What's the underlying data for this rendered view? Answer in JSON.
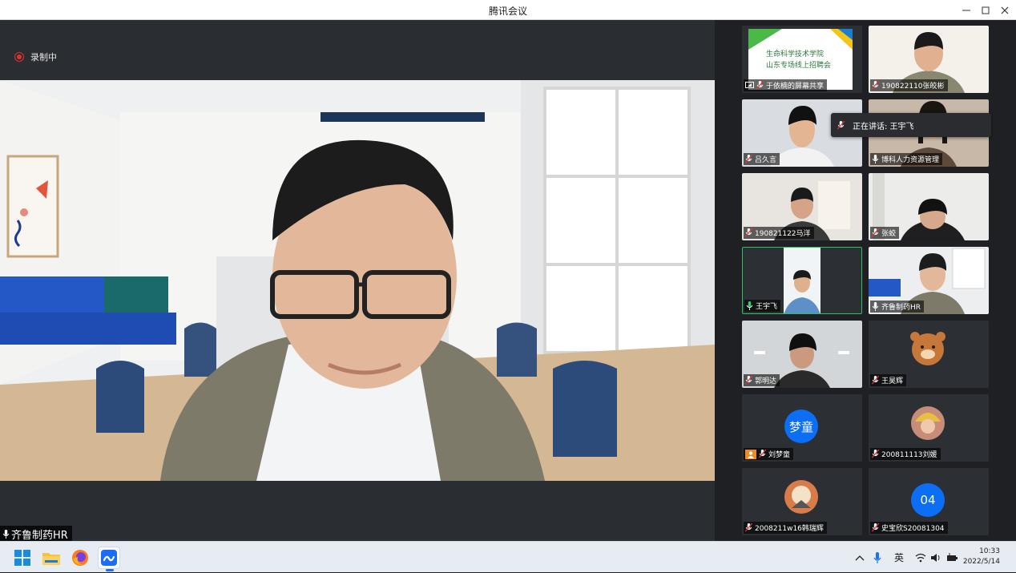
{
  "window": {
    "title": "腾讯会议"
  },
  "main": {
    "recording_label": "录制中",
    "active_speaker": "齐鲁制药HR"
  },
  "tooltip": {
    "speaking_text": "正在讲话: 王宇飞"
  },
  "tiles": [
    {
      "name": "于依楠的屏幕共享",
      "share_title_1": "生命科学技术学院",
      "share_title_2": "山东专场线上招聘会"
    },
    {
      "name": "190822110张皎彬"
    },
    {
      "name": "吕久言"
    },
    {
      "name": "博科人力资源管理"
    },
    {
      "name": "190821122马洋"
    },
    {
      "name": "张蛟"
    },
    {
      "name": "王宇飞"
    },
    {
      "name": "齐鲁制药HR"
    },
    {
      "name": "郭明达"
    },
    {
      "name": "王昊辉"
    },
    {
      "name": "刘梦童",
      "avatar_text": "梦童"
    },
    {
      "name": "200811113刘媛"
    },
    {
      "name": "2008211w16韩瑞辉"
    },
    {
      "name": "史宝欣S20081304",
      "avatar_text": "04"
    }
  ],
  "taskbar": {
    "ime": "英",
    "time": "10:33",
    "date": "2022/5/14"
  },
  "colors": {
    "accent": "#0b6ef5",
    "active_border": "#2fbf5f",
    "recording": "#dd3333"
  }
}
